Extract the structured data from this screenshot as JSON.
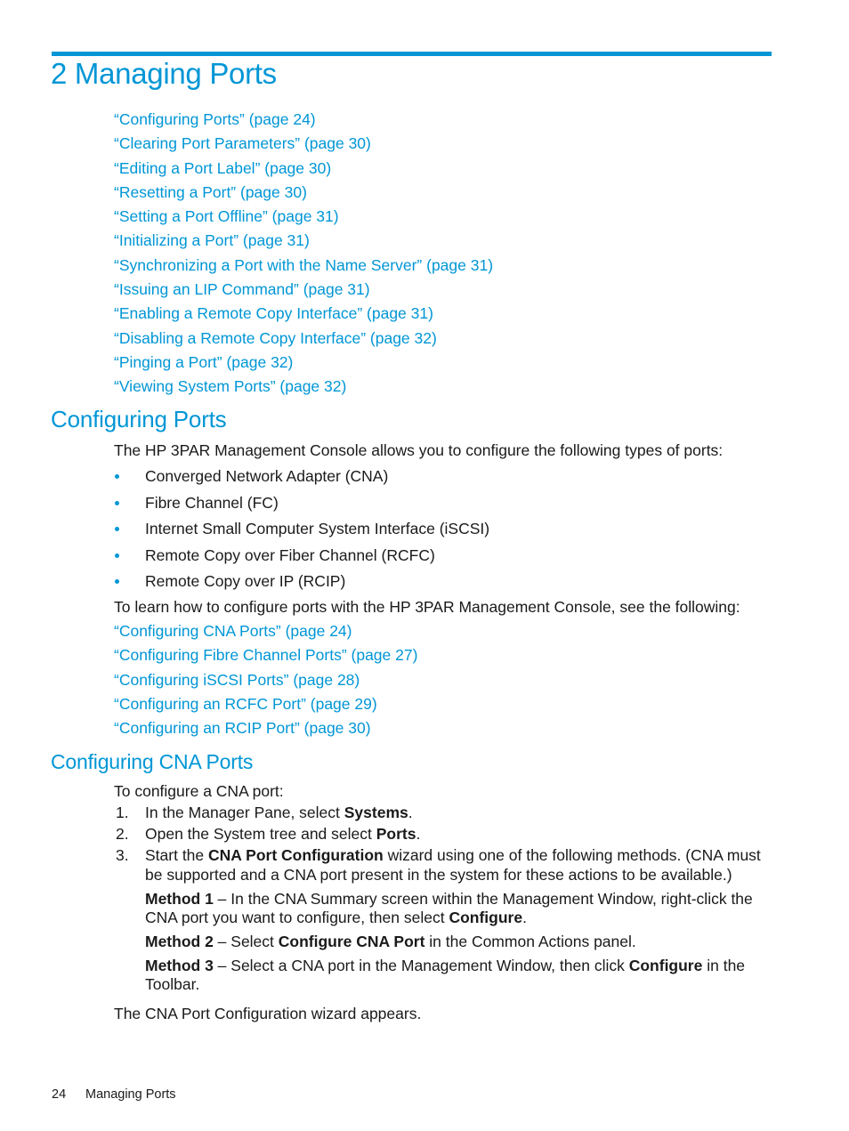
{
  "chapter": {
    "number": "2",
    "title": "2 Managing Ports"
  },
  "toc": [
    "“Configuring Ports” (page 24)",
    "“Clearing Port Parameters” (page 30)",
    "“Editing a Port Label” (page 30)",
    "“Resetting a Port” (page 30)",
    "“Setting a Port Offline” (page 31)",
    "“Initializing a Port” (page 31)",
    "“Synchronizing a Port with the Name Server” (page 31)",
    "“Issuing an LIP Command” (page 31)",
    "“Enabling a Remote Copy Interface” (page 31)",
    "“Disabling a Remote Copy Interface” (page 32)",
    "“Pinging a Port” (page 32)",
    "“Viewing System Ports” (page 32)"
  ],
  "configuring_ports": {
    "heading": "Configuring Ports",
    "intro": "The HP 3PAR Management Console allows you to configure the following types of ports:",
    "port_types": [
      "Converged Network Adapter (CNA)",
      "Fibre Channel (FC)",
      "Internet Small Computer System Interface (iSCSI)",
      "Remote Copy over Fiber Channel (RCFC)",
      "Remote Copy over IP (RCIP)"
    ],
    "learn_more": "To learn how to configure ports with the HP 3PAR Management Console, see the following:",
    "links": [
      "“Configuring CNA Ports” (page 24)",
      "“Configuring Fibre Channel Ports” (page 27)",
      "“Configuring iSCSI Ports” (page 28)",
      "“Configuring an RCFC Port” (page 29)",
      "“Configuring an RCIP Port” (page 30)"
    ]
  },
  "configuring_cna": {
    "heading": "Configuring CNA Ports",
    "intro": "To configure a CNA port:",
    "steps": [
      {
        "num": "1.",
        "pre": "In the Manager Pane, select ",
        "bold": "Systems",
        "post": "."
      },
      {
        "num": "2.",
        "pre": "Open the System tree and select ",
        "bold": "Ports",
        "post": "."
      },
      {
        "num": "3.",
        "pre": "Start the ",
        "bold": "CNA Port Configuration",
        "post": " wizard using one of the following methods. (CNA must be supported and a CNA port present in the system for these actions to be available.)"
      }
    ],
    "methods": [
      {
        "label": "Method 1",
        "pre": " – In the CNA Summary screen within the Management Window, right-click the CNA port you want to configure, then select ",
        "bold": "Configure",
        "post": "."
      },
      {
        "label": "Method 2",
        "pre": " – Select ",
        "bold": "Configure CNA Port",
        "post": " in the Common Actions panel."
      },
      {
        "label": "Method 3",
        "pre": " – Select a CNA port in the Management Window, then click ",
        "bold": "Configure",
        "post": " in the Toolbar."
      }
    ],
    "result": "The CNA Port Configuration wizard appears."
  },
  "footer": {
    "page_number": "24",
    "section": "Managing Ports"
  },
  "colors": {
    "accent": "#0096d6",
    "text": "#1a1a1a"
  }
}
